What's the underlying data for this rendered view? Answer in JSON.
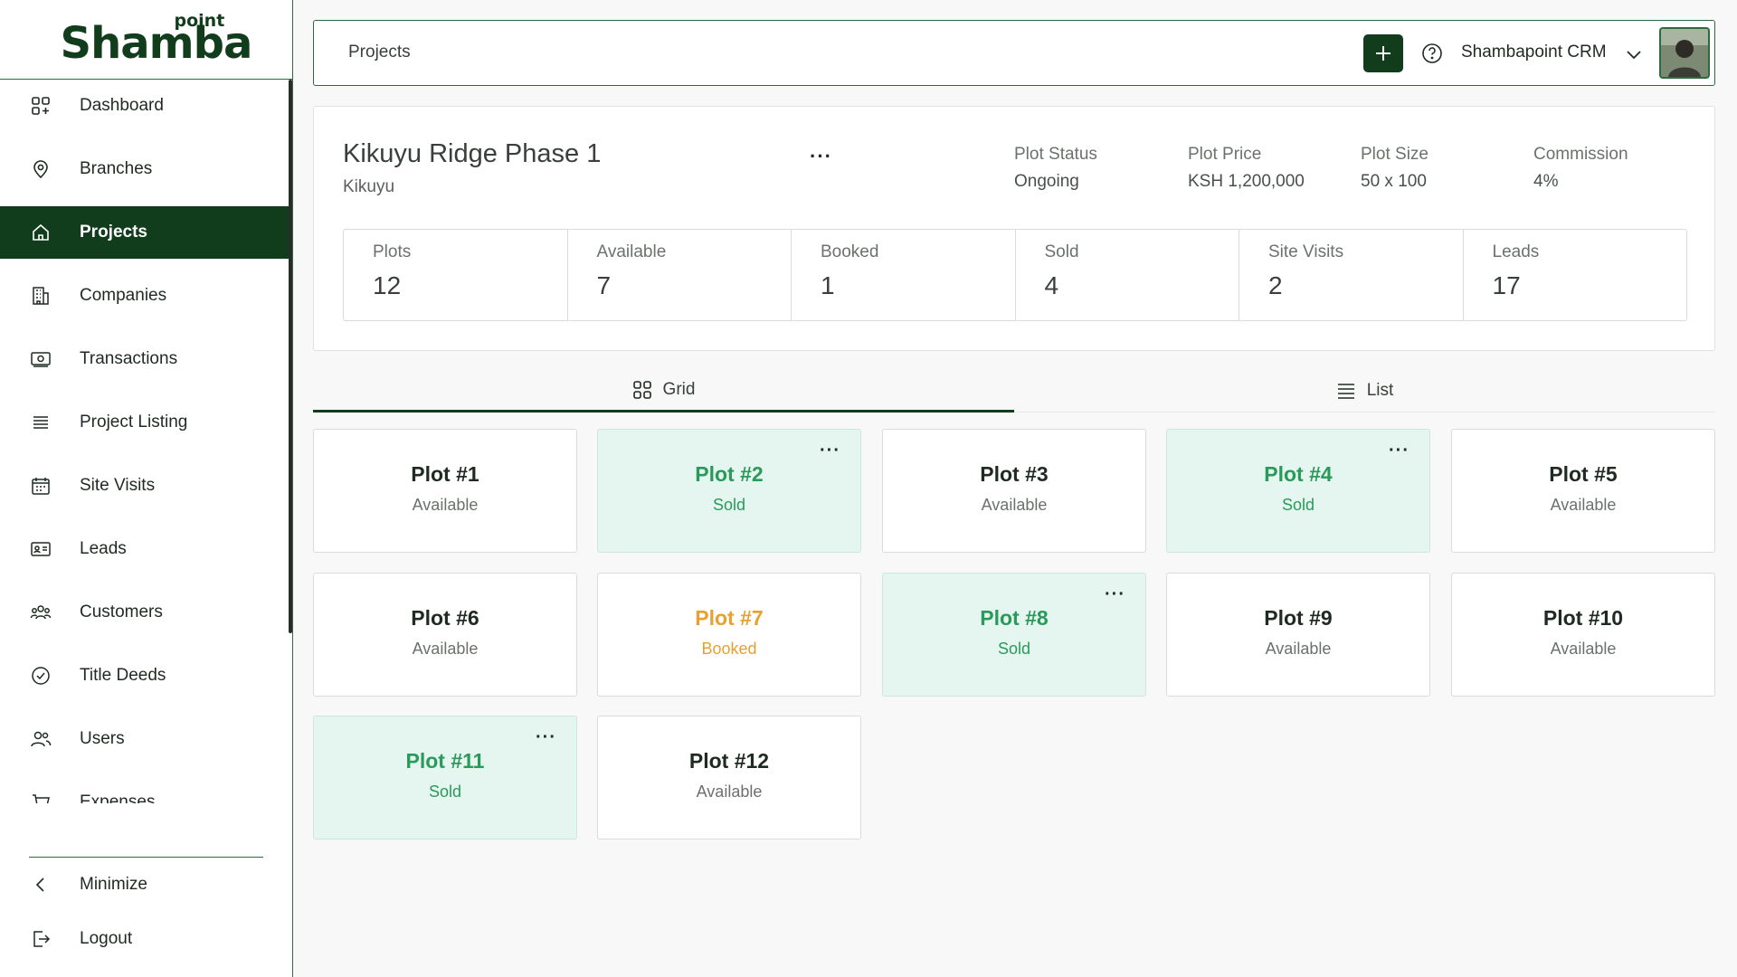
{
  "brand": {
    "logo_main": "Shamba",
    "logo_sub": "point"
  },
  "sidebar": {
    "items": [
      {
        "label": "Dashboard",
        "icon": "dashboard-icon"
      },
      {
        "label": "Branches",
        "icon": "location-pin-icon"
      },
      {
        "label": "Projects",
        "icon": "home-icon",
        "active": true
      },
      {
        "label": "Companies",
        "icon": "building-icon"
      },
      {
        "label": "Transactions",
        "icon": "money-icon"
      },
      {
        "label": "Project Listing",
        "icon": "list-icon"
      },
      {
        "label": "Site Visits",
        "icon": "calendar-icon"
      },
      {
        "label": "Leads",
        "icon": "id-card-icon"
      },
      {
        "label": "Customers",
        "icon": "group-icon"
      },
      {
        "label": "Title Deeds",
        "icon": "check-circle-icon"
      },
      {
        "label": "Users",
        "icon": "users-icon"
      },
      {
        "label": "Expenses",
        "icon": "cart-icon"
      }
    ],
    "minimize_label": "Minimize",
    "logout_label": "Logout"
  },
  "topbar": {
    "breadcrumb": "Projects",
    "org_name": "Shambapoint CRM"
  },
  "project": {
    "title": "Kikuyu Ridge Phase 1",
    "location": "Kikuyu",
    "meta": [
      {
        "label": "Plot Status",
        "value": "Ongoing"
      },
      {
        "label": "Plot Price",
        "value": "KSH 1,200,000"
      },
      {
        "label": "Plot Size",
        "value": "50 x 100"
      },
      {
        "label": "Commission",
        "value": "4%"
      }
    ],
    "stats": [
      {
        "label": "Plots",
        "value": "12"
      },
      {
        "label": "Available",
        "value": "7"
      },
      {
        "label": "Booked",
        "value": "1"
      },
      {
        "label": "Sold",
        "value": "4"
      },
      {
        "label": "Site Visits",
        "value": "2"
      },
      {
        "label": "Leads",
        "value": "17"
      }
    ]
  },
  "tabs": {
    "grid_label": "Grid",
    "list_label": "List",
    "active": "grid"
  },
  "plots": [
    {
      "name": "Plot #1",
      "status": "Available"
    },
    {
      "name": "Plot #2",
      "status": "Sold"
    },
    {
      "name": "Plot #3",
      "status": "Available"
    },
    {
      "name": "Plot #4",
      "status": "Sold"
    },
    {
      "name": "Plot #5",
      "status": "Available"
    },
    {
      "name": "Plot #6",
      "status": "Available"
    },
    {
      "name": "Plot #7",
      "status": "Booked"
    },
    {
      "name": "Plot #8",
      "status": "Sold"
    },
    {
      "name": "Plot #9",
      "status": "Available"
    },
    {
      "name": "Plot #10",
      "status": "Available"
    },
    {
      "name": "Plot #11",
      "status": "Sold"
    },
    {
      "name": "Plot #12",
      "status": "Available"
    }
  ],
  "colors": {
    "brand_dark_green": "#113d1c",
    "sold_green": "#2a9a5a",
    "sold_bg": "#e5f5ef",
    "booked_orange": "#e8a12e"
  }
}
